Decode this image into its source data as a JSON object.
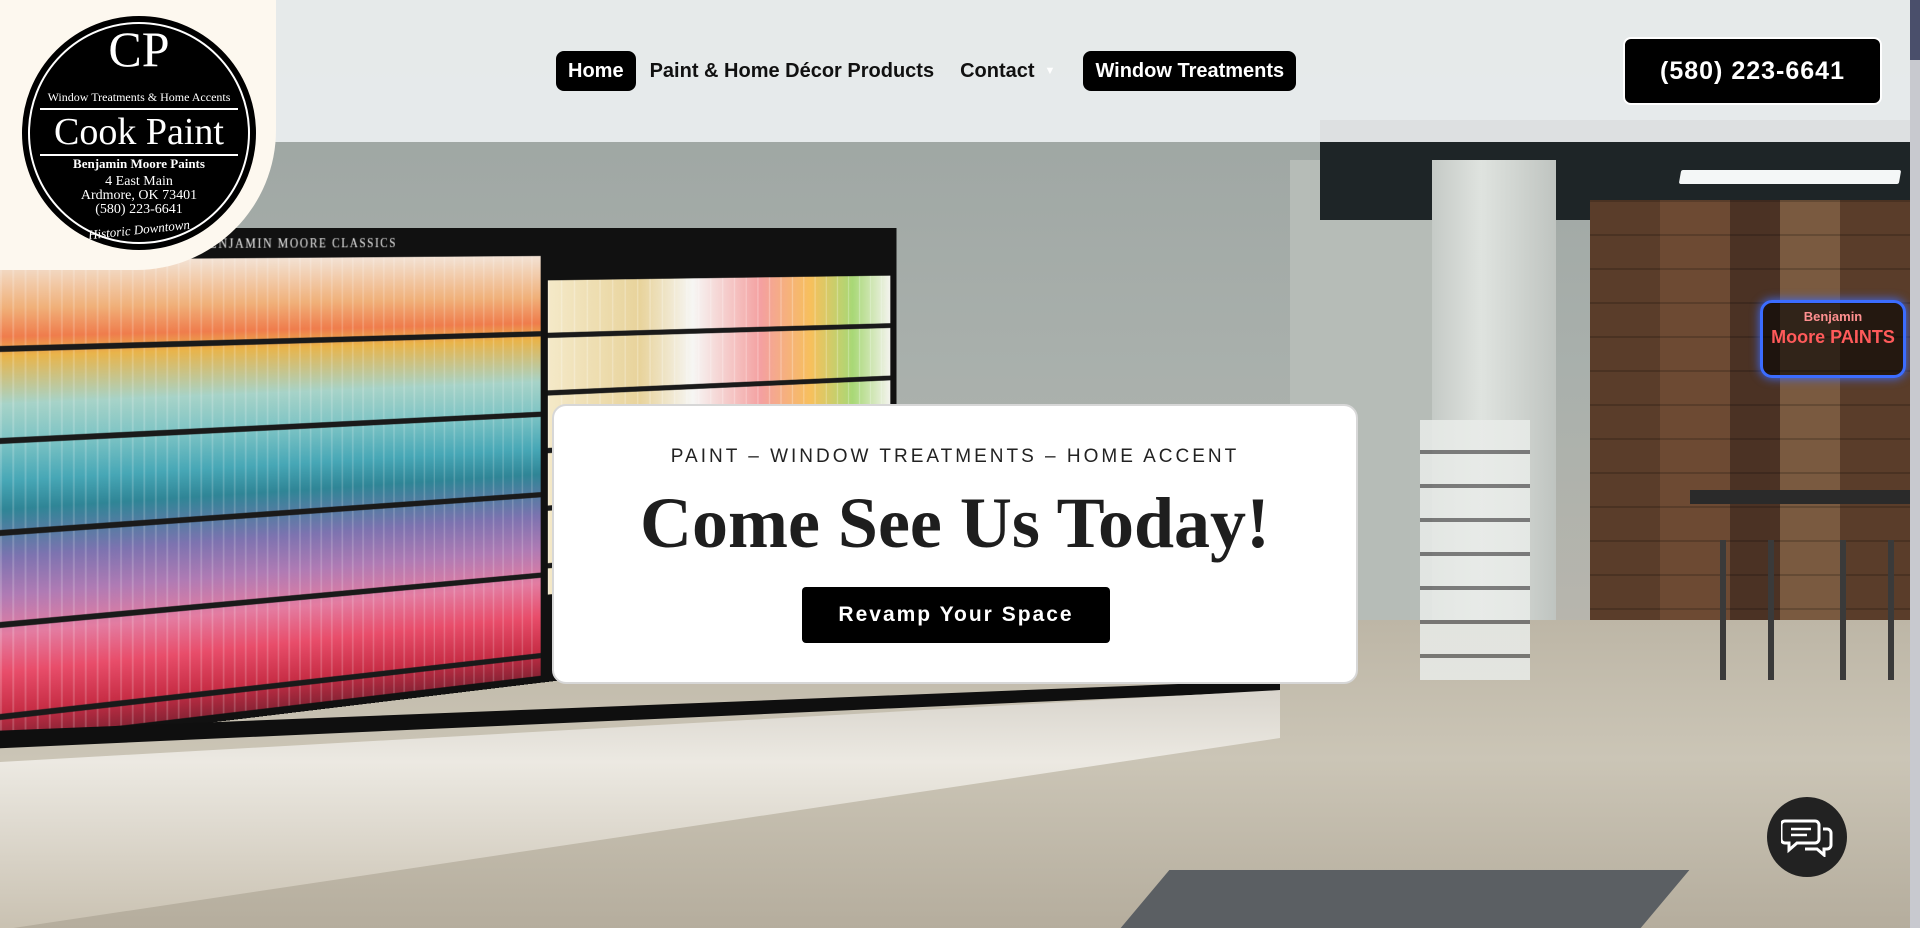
{
  "logo": {
    "monogram": "CP",
    "tagline": "Window Treatments & Home Accents",
    "name": "Cook Paint",
    "brand_line": "Benjamin Moore Paints",
    "address_line1": "4 East Main",
    "address_line2": "Ardmore, OK 73401",
    "phone": "(580) 223-6641",
    "arc_text": "Historic Downtown"
  },
  "nav": {
    "items": [
      {
        "label": "Home",
        "active": true
      },
      {
        "label": "Paint & Home Décor Products"
      },
      {
        "label": "Contact",
        "has_dropdown": true
      },
      {
        "label": "Window Treatments",
        "highlight": true
      }
    ]
  },
  "header": {
    "phone_button": "(580) 223-6641"
  },
  "hero": {
    "kicker": "PAINT – WINDOW TREATMENTS – HOME ACCENT",
    "headline": "Come See Us Today!",
    "cta": "Revamp Your Space",
    "store_sign": "BENJAMIN MOORE CLASSICS",
    "neon_sign_line1": "Benjamin",
    "neon_sign_line2": "Moore PAINTS"
  },
  "chat": {
    "icon": "chat-bubbles-icon"
  },
  "colors": {
    "header_bg": "#eceff0",
    "button_bg": "#000000",
    "button_text": "#ffffff",
    "card_bg": "#ffffff"
  }
}
